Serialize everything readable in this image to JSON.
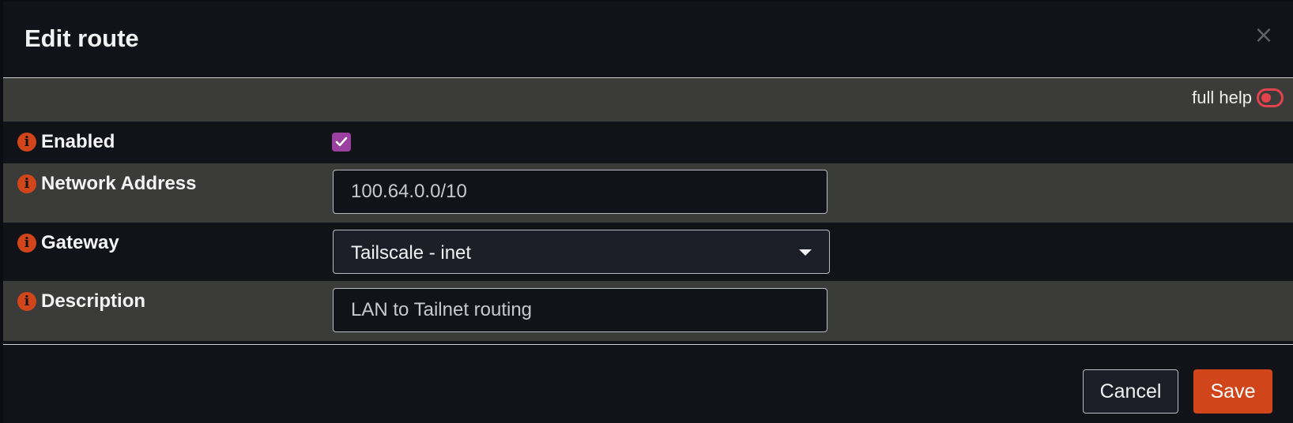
{
  "dialog": {
    "title": "Edit route",
    "close_symbol": "×",
    "close_icon": "close-icon"
  },
  "help": {
    "label": "full help",
    "enabled": false,
    "toggle_color": "#e4434e"
  },
  "form": {
    "info_icon": "info-icon",
    "info_symbol": "i",
    "enabled": {
      "label": "Enabled",
      "checked": true
    },
    "network_address": {
      "label": "Network Address",
      "value": "100.64.0.0/10"
    },
    "gateway": {
      "label": "Gateway",
      "selected": "Tailscale - inet"
    },
    "description": {
      "label": "Description",
      "value": "LAN to Tailnet routing"
    }
  },
  "footer": {
    "cancel_label": "Cancel",
    "save_label": "Save"
  },
  "colors": {
    "accent": "#d1451a",
    "checkbox": "#9b3fa0",
    "background": "#121318",
    "row_alt": "#3b3b3a"
  }
}
